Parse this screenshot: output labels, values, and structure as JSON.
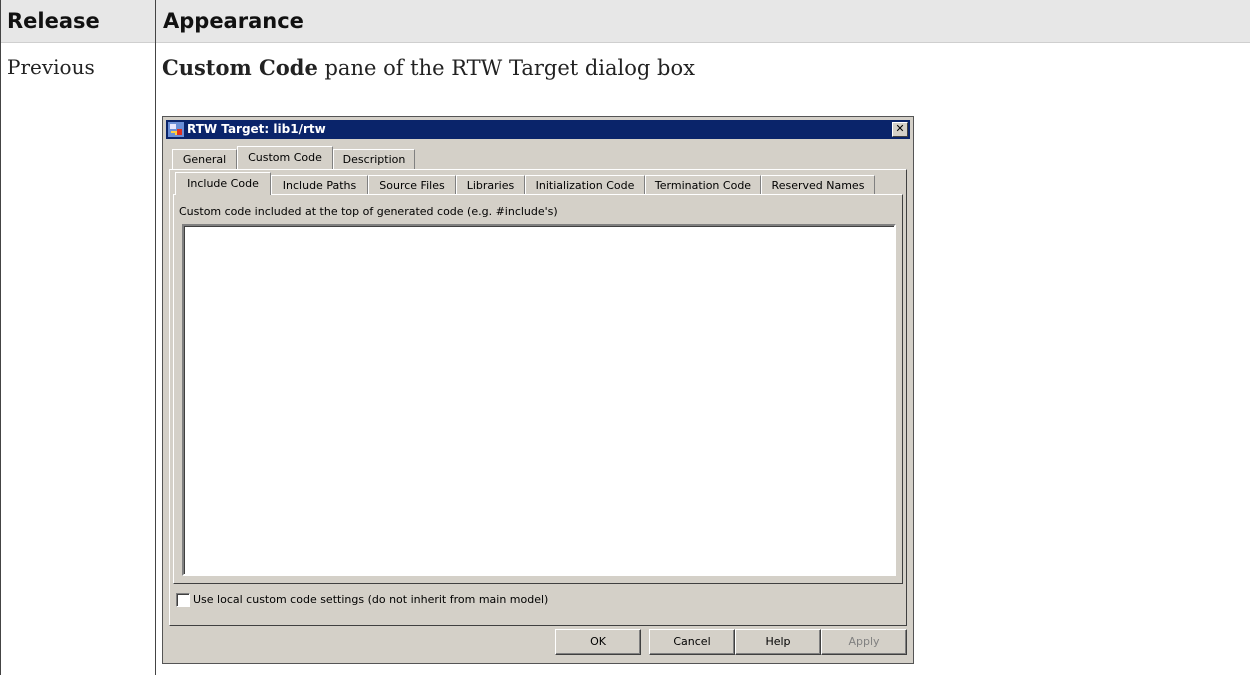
{
  "table": {
    "header_release": "Release",
    "header_appearance": "Appearance",
    "row_release": "Previous",
    "row_caption_bold": "Custom Code",
    "row_caption_rest": " pane of the RTW Target dialog box"
  },
  "dialog": {
    "title": "RTW Target: lib1/rtw",
    "close_glyph": "✕",
    "tabs": [
      "General",
      "Custom Code",
      "Description"
    ],
    "active_tab": "Custom Code",
    "subtabs": [
      "Include Code",
      "Include Paths",
      "Source Files",
      "Libraries",
      "Initialization Code",
      "Termination Code",
      "Reserved Names"
    ],
    "active_subtab": "Include Code",
    "description": "Custom code included at the top of generated code (e.g. #include's)",
    "code_value": "",
    "checkbox_label": "Use local custom code settings (do not inherit from main model)",
    "checkbox_checked": false,
    "buttons": {
      "ok": "OK",
      "cancel": "Cancel",
      "help": "Help",
      "apply": "Apply"
    }
  },
  "colors": {
    "titlebar": "#0a246a",
    "dialog_face": "#d4d0c8",
    "header_bg": "#e7e7e7"
  }
}
